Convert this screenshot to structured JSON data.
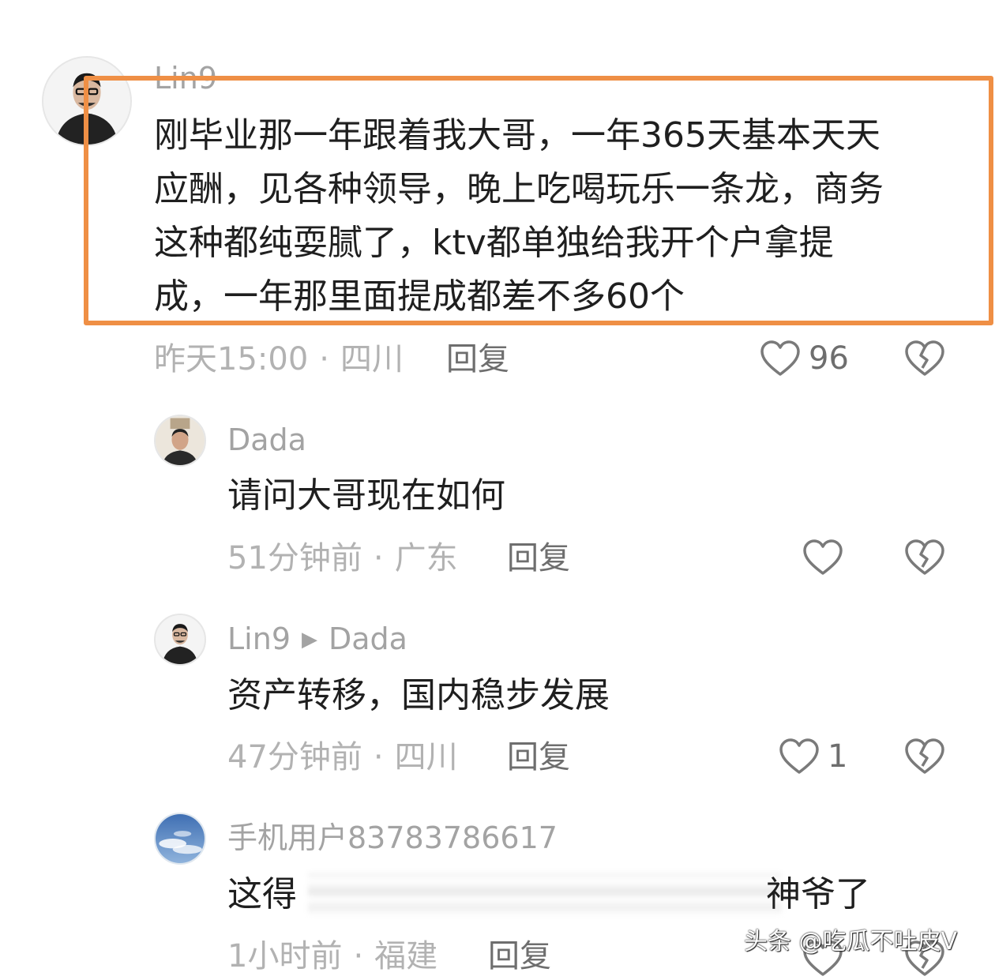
{
  "comments": [
    {
      "username": "Lin9",
      "text_lines": [
        "刚毕业那一年跟着我大哥，一年365天基本天天",
        "应酬，见各种领导，晚上吃喝玩乐一条龙，商务",
        "这种都纯耍腻了，ktv都单独给我开个户拿提",
        "成，一年那里面提成都差不多60个"
      ],
      "time": "昨天15:00",
      "location": "四川",
      "reply_label": "回复",
      "likes": "96",
      "highlighted": true,
      "avatar_icon": "man-glasses-avatar-icon"
    },
    {
      "username": "Dada",
      "text": "请问大哥现在如何",
      "time": "51分钟前",
      "location": "广东",
      "reply_label": "回复",
      "likes": "",
      "avatar_icon": "man-portrait-avatar-icon"
    },
    {
      "username": "Lin9",
      "reply_to": "Dada",
      "text": "资产转移，国内稳步发展",
      "time": "47分钟前",
      "location": "四川",
      "reply_label": "回复",
      "likes": "1",
      "avatar_icon": "man-glasses-avatar-icon"
    },
    {
      "username": "手机用户83783786617",
      "text_visible_start": "这得",
      "text_visible_end": "神爷了",
      "time": "1小时前",
      "location": "福建",
      "reply_label": "回复",
      "likes": "",
      "avatar_icon": "sky-avatar-icon"
    }
  ],
  "separator": "·",
  "reply_arrow": "▶",
  "watermark": "头条 @吃瓜不吐皮V",
  "colors": {
    "highlight_border": "#ef8f45",
    "meta_text": "#b2b2b2",
    "body_text": "#1f1f1f"
  }
}
